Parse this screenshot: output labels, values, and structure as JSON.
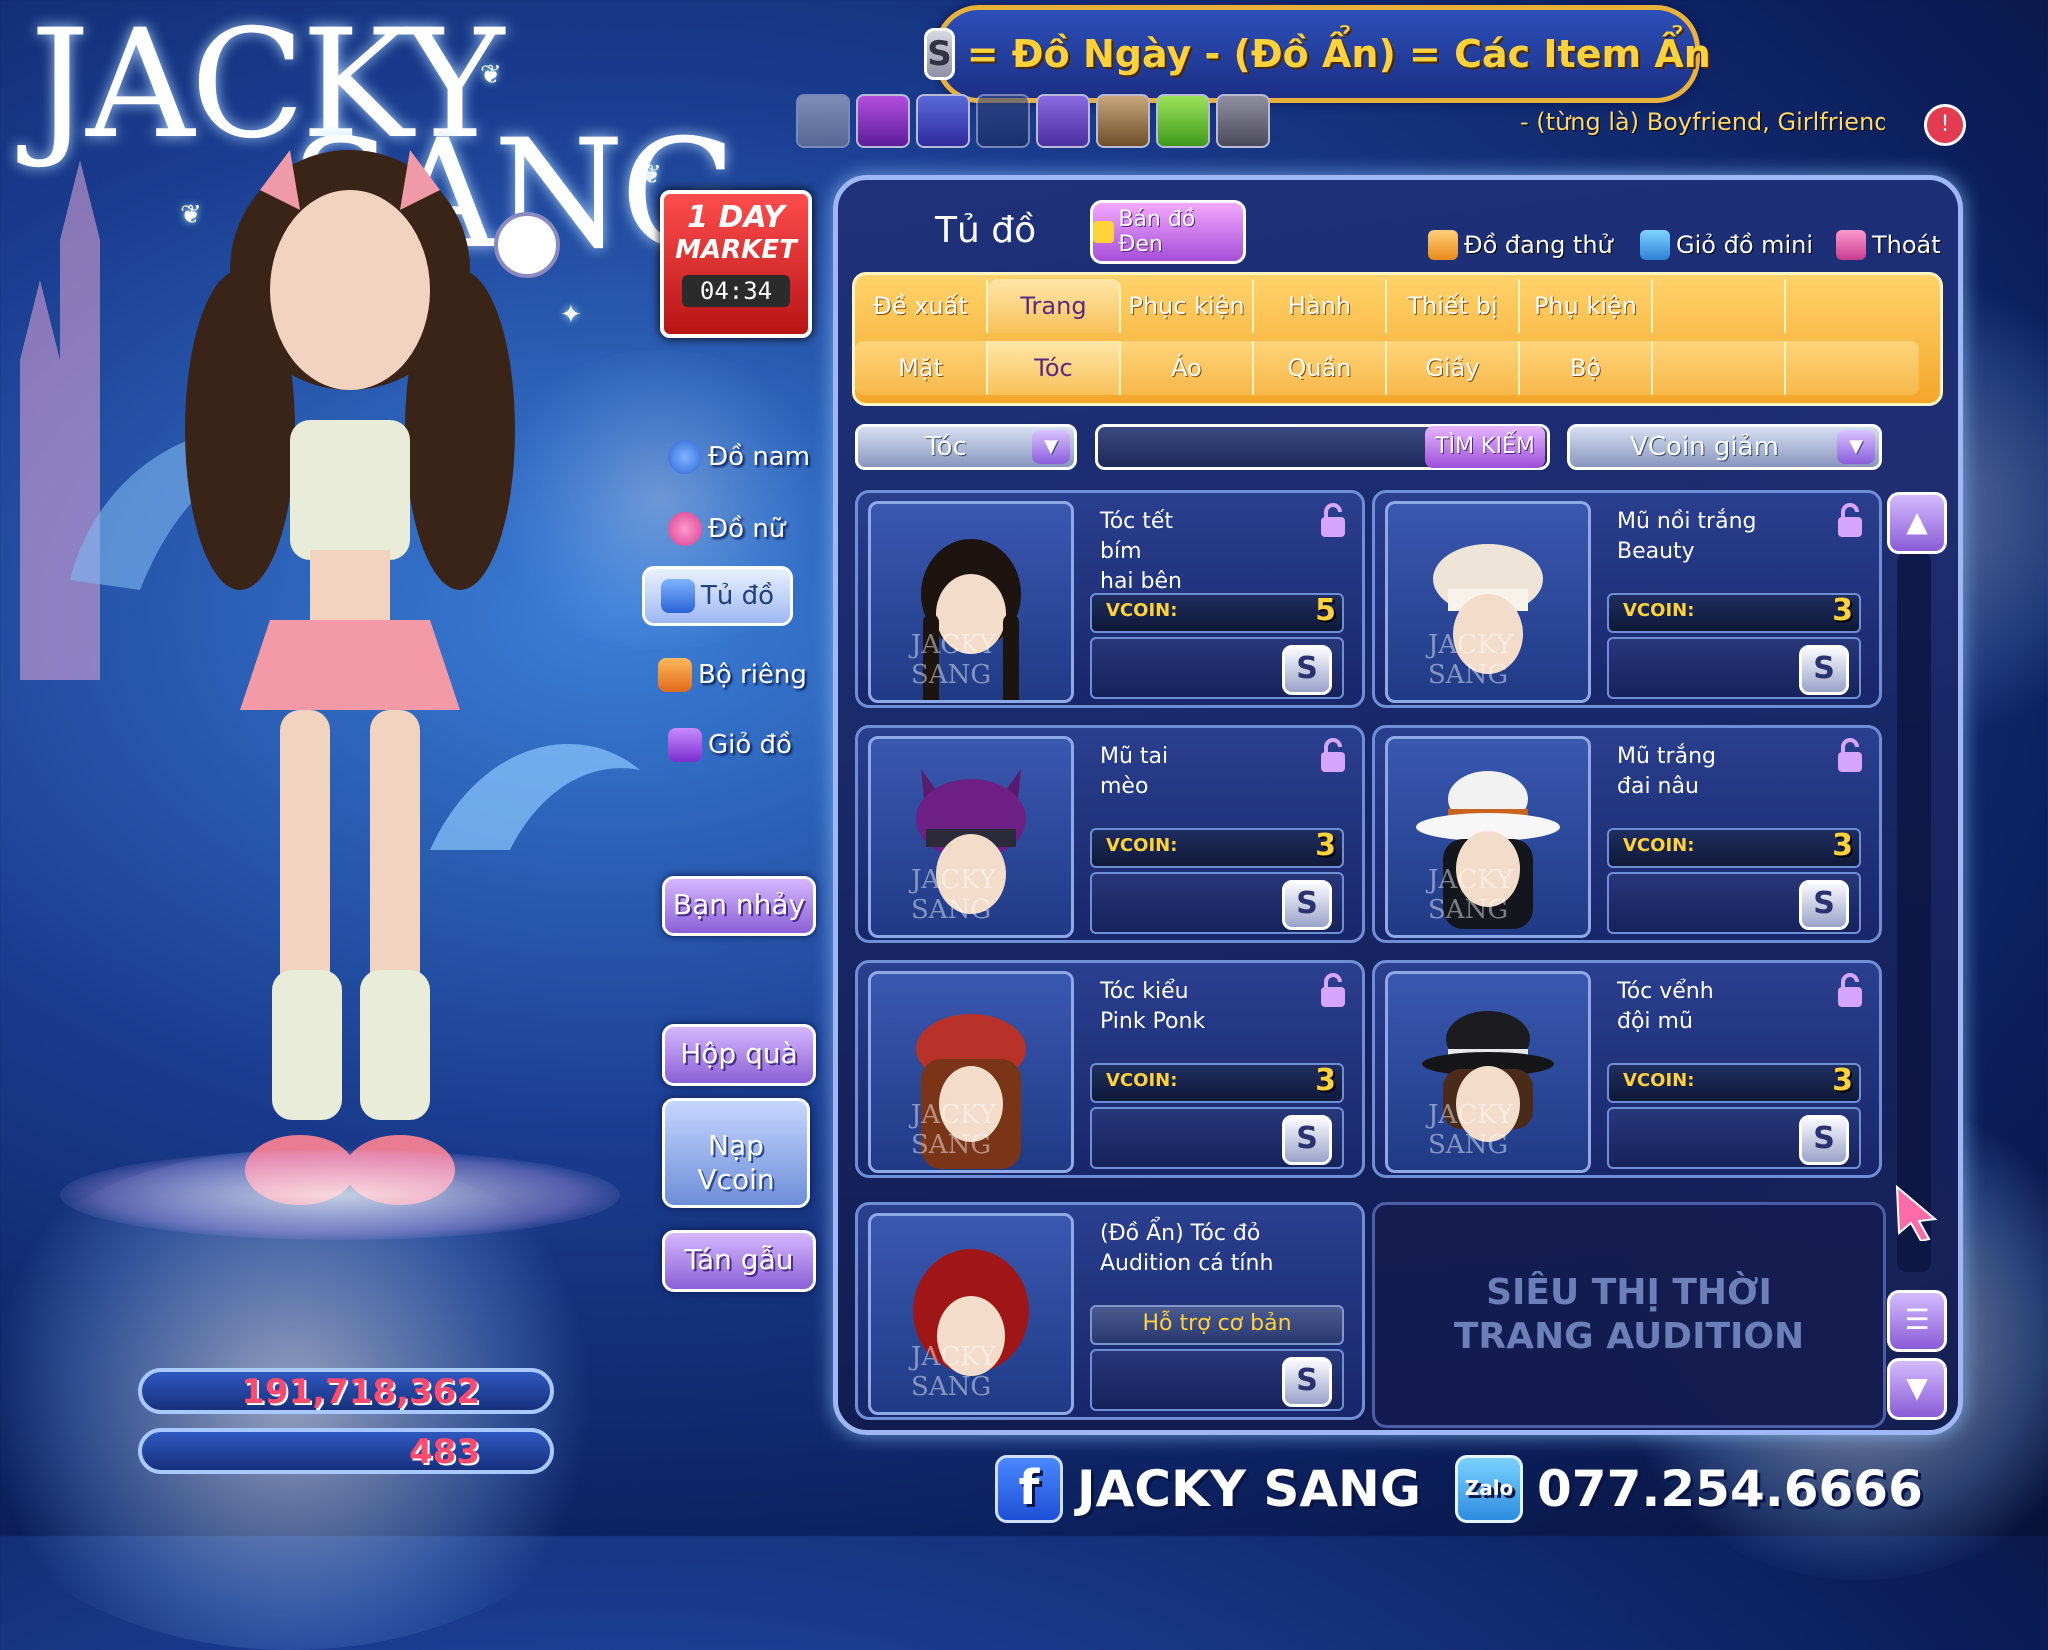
{
  "brand": {
    "line1": "JACKY",
    "line2": "SANG"
  },
  "banner": {
    "badge": "S",
    "text": "= Đồ Ngày - (Đồ Ẩn) = Các Item Ẩn"
  },
  "ticker": "- (từng là) Boyfriend, Girlfriend",
  "market": {
    "line1": "1 DAY",
    "line2": "MARKET",
    "timer": "04:34"
  },
  "left_menu": {
    "male": "Đồ nam",
    "female": "Đồ nữ",
    "wardrobe": "Tủ đồ",
    "private": "Bộ riêng",
    "cart": "Giỏ đồ"
  },
  "side_buttons": {
    "partner": "Bạn nhảy",
    "giftbox": "Hộp quà",
    "topup_line1": "Nạp",
    "topup_line2": "Vcoin",
    "chat": "Tán gẫu"
  },
  "currency": {
    "den": "191,718,362",
    "vcoin": "483"
  },
  "panel": {
    "title": "Tủ đồ",
    "black_market": "Bán đồ Đen",
    "trying": "Đồ đang thử",
    "mini_cart": "Giỏ đồ mini",
    "exit": "Thoát"
  },
  "tabs_main": [
    "Đề xuất",
    "Trang phục",
    "Phục kiện",
    "Hành động",
    "Thiết bị",
    "Phụ kiện",
    "",
    ""
  ],
  "tabs_sub": [
    "Mặt",
    "Tóc",
    "Áo",
    "Quần",
    "Giầy",
    "Bộ",
    "",
    ""
  ],
  "filters": {
    "category": "Tóc",
    "search_button": "TÌM KIẾM",
    "sort": "VCoin giảm"
  },
  "items": [
    {
      "name_lines": [
        "Tóc tết",
        "bím",
        "hai bên"
      ],
      "vcoin_label": "VCOIN:",
      "vcoin": "5",
      "s": "S"
    },
    {
      "name_lines": [
        "Mũ nồi trắng",
        "Beauty"
      ],
      "vcoin_label": "VCOIN:",
      "vcoin": "3",
      "s": "S"
    },
    {
      "name_lines": [
        "Mũ tai",
        "mèo"
      ],
      "vcoin_label": "VCOIN:",
      "vcoin": "3",
      "s": "S"
    },
    {
      "name_lines": [
        "Mũ trắng",
        "đai nâu"
      ],
      "vcoin_label": "VCOIN:",
      "vcoin": "3",
      "s": "S"
    },
    {
      "name_lines": [
        "Tóc kiểu",
        "Pink Ponk"
      ],
      "vcoin_label": "VCOIN:",
      "vcoin": "3",
      "s": "S"
    },
    {
      "name_lines": [
        "Tóc vểnh",
        "đội mũ"
      ],
      "vcoin_label": "VCOIN:",
      "vcoin": "3",
      "s": "S"
    },
    {
      "name_lines": [
        "(Đồ Ẩn) Tóc đỏ",
        "Audition cá tính"
      ],
      "support": "Hỗ trợ cơ bản",
      "s": "S"
    }
  ],
  "thumb_logo": "JACKY SANG",
  "promo": {
    "line1": "SIÊU THỊ THỜI",
    "line2": "TRANG AUDITION"
  },
  "footer": {
    "fb_icon": "f",
    "name": "JACKY SANG",
    "zalo_icon": "Zalo",
    "phone": "077.254.6666"
  },
  "colors": {
    "accent_gold": "#ffd23a",
    "panel_border": "#9fb7f5",
    "tab_orange": "#f4a62a",
    "money_pink": "#ff4a6e"
  }
}
